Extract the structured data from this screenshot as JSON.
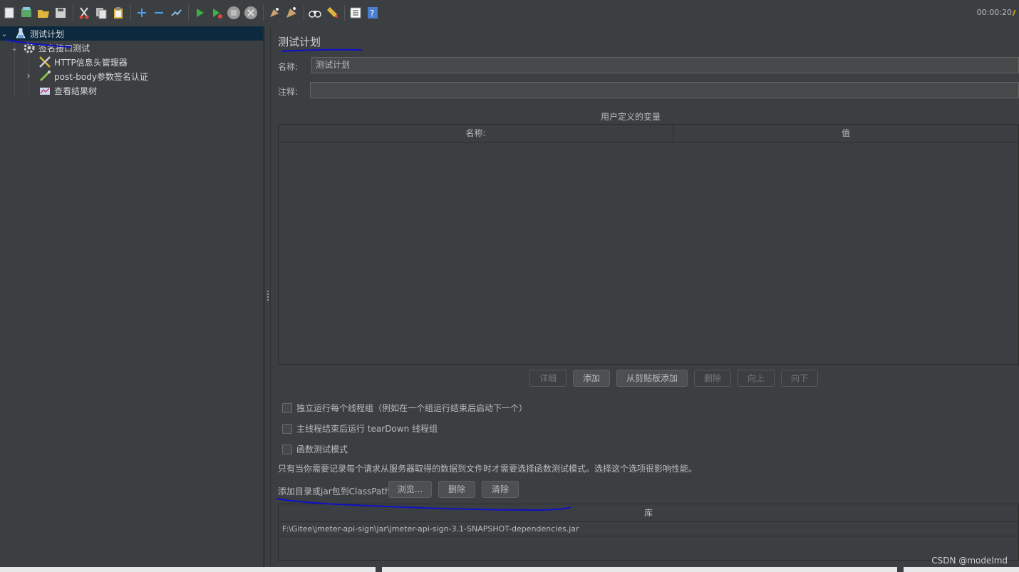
{
  "toolbar": {
    "buttons": [
      {
        "name": "new-icon",
        "color": "#e8e8e8"
      },
      {
        "name": "templates-icon",
        "color": "#59a869"
      },
      {
        "name": "open-icon",
        "color": "#e0b43c"
      },
      {
        "name": "save-icon",
        "color": "#cfcfcf"
      },
      {
        "name": "cut-icon",
        "color": "#d94a3c"
      },
      {
        "name": "copy-icon",
        "color": "#cfcfcf"
      },
      {
        "name": "paste-icon",
        "color": "#e0b43c"
      },
      {
        "name": "expand-icon",
        "color": "#4a9eed"
      },
      {
        "name": "collapse-icon",
        "color": "#4a9eed"
      },
      {
        "name": "toggle-icon",
        "color": "#8fb8e0"
      },
      {
        "name": "start-icon",
        "color": "#3fae49"
      },
      {
        "name": "start-no-pause-icon",
        "color": "#3fae49"
      },
      {
        "name": "stop-icon",
        "color": "#9a9a9a"
      },
      {
        "name": "shutdown-icon",
        "color": "#9a9a9a"
      },
      {
        "name": "clear-icon",
        "color": "#c9a36b"
      },
      {
        "name": "clear-all-icon",
        "color": "#c9a36b"
      },
      {
        "name": "search-icon",
        "color": "#e0e0e0"
      },
      {
        "name": "reset-search-icon",
        "color": "#e0b43c"
      },
      {
        "name": "function-helper-icon",
        "color": "#e0e0e0"
      },
      {
        "name": "help-icon",
        "color": "#4a7ecf"
      }
    ],
    "timer": "00:00:20"
  },
  "tree": {
    "items": [
      {
        "label": "测试计划",
        "level": 0,
        "arrow": "⌄",
        "icon": "test-plan-icon",
        "selected": true
      },
      {
        "label": "签名接口测试",
        "level": 1,
        "arrow": "⌄",
        "icon": "thread-group-icon",
        "selected": false
      },
      {
        "label": "HTTP信息头管理器",
        "level": 2,
        "arrow": "",
        "icon": "config-element-icon",
        "selected": false
      },
      {
        "label": "post-body参数签名认证",
        "level": 2,
        "arrow": "›",
        "icon": "pre-processor-icon",
        "selected": false
      },
      {
        "label": "查看结果树",
        "level": 2,
        "arrow": "",
        "icon": "listener-icon",
        "selected": false
      }
    ]
  },
  "panel": {
    "title": "测试计划",
    "name_label": "名称:",
    "name_value": "测试计划",
    "comment_label": "注释:",
    "comment_value": "",
    "variables": {
      "title": "用户定义的变量",
      "columns": [
        "名称:",
        "值"
      ],
      "rows": []
    },
    "var_buttons": [
      {
        "label": "详细",
        "enabled": false
      },
      {
        "label": "添加",
        "enabled": true
      },
      {
        "label": "从剪贴板添加",
        "enabled": true
      },
      {
        "label": "删除",
        "enabled": false
      },
      {
        "label": "向上",
        "enabled": false
      },
      {
        "label": "向下",
        "enabled": false
      }
    ],
    "options": [
      {
        "label": "独立运行每个线程组（例如在一个组运行结束后启动下一个）",
        "checked": false
      },
      {
        "label": "主线程结束后运行 tearDown 线程组",
        "checked": false
      },
      {
        "label": "函数测试模式",
        "checked": false
      }
    ],
    "functional_note": "只有当你需要记录每个请求从服务器取得的数据到文件时才需要选择函数测试模式。选择这个选项很影响性能。",
    "classpath": {
      "label": "添加目录或jar包到ClassPath",
      "browse_label": "浏览...",
      "delete_label": "删除",
      "clear_label": "清除",
      "column": "库",
      "rows": [
        "F:\\Gitee\\jmeter-api-sign\\jar\\jmeter-api-sign-3.1-SNAPSHOT-dependencies.jar"
      ]
    }
  },
  "watermark": "CSDN @modelmd",
  "annotation_color": "#1010c8"
}
